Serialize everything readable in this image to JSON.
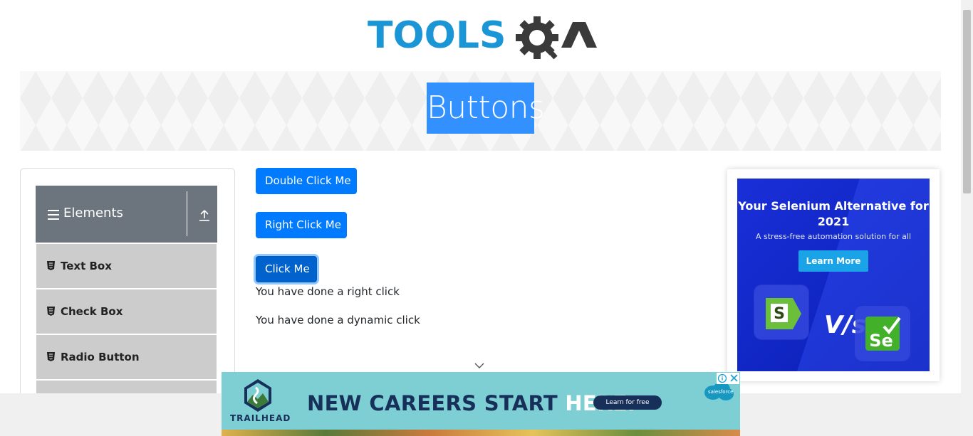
{
  "brand": {
    "logo_text_primary": "TOOLS",
    "logo_text_secondary": "QA",
    "primary_color": "#1a96d6",
    "secondary_color": "#3a3a3a"
  },
  "banner": {
    "title": "Buttons"
  },
  "sidebar": {
    "group": {
      "icon": "menu-icon",
      "label": "Elements",
      "collapse_icon": "upload-icon"
    },
    "items": [
      {
        "icon": "html5-icon",
        "label": "Text Box"
      },
      {
        "icon": "html5-icon",
        "label": "Check Box"
      },
      {
        "icon": "html5-icon",
        "label": "Radio Button"
      }
    ]
  },
  "main": {
    "double_click_button": "Double Click Me",
    "right_click_button": "Right Click Me",
    "click_button": "Click Me",
    "right_click_message": "You have done a right click",
    "dynamic_click_message": "You have done a dynamic click"
  },
  "side_ad": {
    "headline": "Your Selenium Alternative for 2021",
    "subtext": "A stress-free automation solution for all",
    "cta": "Learn More",
    "versus": "V/s",
    "left_logo": "S",
    "right_logo": "Se"
  },
  "bottom_ad": {
    "brand": "TRAILHEAD",
    "headline_part1": "NEW CAREERS START ",
    "headline_part2": "HERE.",
    "cta": "Learn for free",
    "sponsor": "salesforce"
  },
  "colors": {
    "button_blue": "#007bff",
    "sidebar_header": "#6c757d",
    "sidebar_item": "#cccccc",
    "title_highlight": "#3390ff"
  }
}
